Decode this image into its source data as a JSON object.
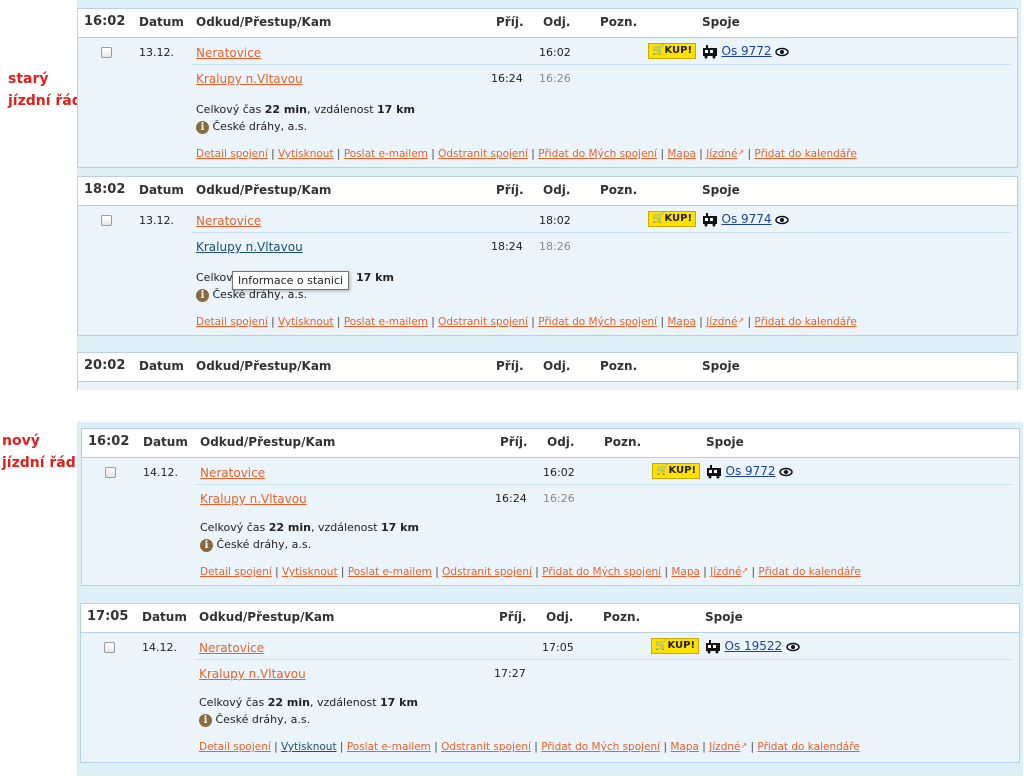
{
  "labels": {
    "old_line1": "starý",
    "old_line2": "jízdní řád",
    "new_line1": "nový",
    "new_line2": "jízdní řád"
  },
  "header": {
    "datum": "Datum",
    "route": "Odkud/Přestup/Kam",
    "arr": "Příj.",
    "dep": "Odj.",
    "note": "Pozn.",
    "trains": "Spoje"
  },
  "kup_label": "KUP!",
  "links": {
    "detail": "Detail spojení",
    "print": "Vytisknout",
    "email": "Poslat e-mailem",
    "remove": "Odstranit spojení",
    "add_mine": "Přidat do Mých spojení",
    "map": "Mapa",
    "tickets": "Jízdné",
    "calendar": "Přidat do kalendáře",
    "sep": "|"
  },
  "tooltip": "Informace o stanici",
  "connections": [
    {
      "time": "16:02",
      "date": "13.12.",
      "from": "Neratovice",
      "dep": "16:02",
      "to": "Kralupy n.Vltavou",
      "arr": "16:24",
      "next_dep": "16:26",
      "train": "Os 9772",
      "summary_prefix": "Celkový čas ",
      "duration": "22 min",
      "summary_mid": ", vzdálenost ",
      "distance": "17 km",
      "carrier": "České dráhy, a.s."
    },
    {
      "time": "18:02",
      "date": "13.12.",
      "from": "Neratovice",
      "dep": "18:02",
      "to": "Kralupy n.Vltavou",
      "arr": "18:24",
      "next_dep": "18:26",
      "train": "Os 9774",
      "summary_prefix": "Celkový",
      "distance": "17 km",
      "carrier": "České dráhy, a.s."
    },
    {
      "time": "20:02"
    },
    {
      "time": "16:02",
      "date": "14.12.",
      "from": "Neratovice",
      "dep": "16:02",
      "to": "Kralupy n.Vltavou",
      "arr": "16:24",
      "next_dep": "16:26",
      "train": "Os 9772",
      "summary_prefix": "Celkový čas ",
      "duration": "22 min",
      "summary_mid": ", vzdálenost ",
      "distance": "17 km",
      "carrier": "České dráhy, a.s."
    },
    {
      "time": "17:05",
      "date": "14.12.",
      "from": "Neratovice",
      "dep": "17:05",
      "to": "Kralupy n.Vltavou",
      "arr": "17:27",
      "train": "Os 19522",
      "summary_prefix": "Celkový čas ",
      "duration": "22 min",
      "summary_mid": ", vzdálenost ",
      "distance": "17 km",
      "carrier": "České dráhy, a.s."
    }
  ]
}
